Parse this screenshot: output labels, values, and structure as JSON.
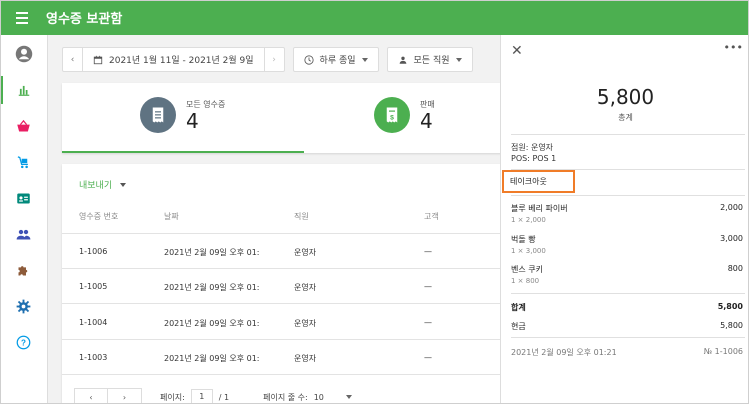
{
  "app": {
    "title": "영수증 보관함"
  },
  "sidebar": {
    "items": [
      {
        "icon": "account-circle-icon"
      },
      {
        "icon": "bar-chart-icon",
        "active": true
      },
      {
        "icon": "basket-icon"
      },
      {
        "icon": "cart-icon"
      },
      {
        "icon": "id-card-icon"
      },
      {
        "icon": "people-icon"
      },
      {
        "icon": "puzzle-icon"
      },
      {
        "icon": "gear-icon"
      },
      {
        "icon": "help-icon"
      }
    ],
    "accent": "#4caf50"
  },
  "filters": {
    "date_range": "2021년 1월 11일 - 2021년 2월 9일",
    "time": "하루 종일",
    "employee": "모든 직원"
  },
  "summary": {
    "all_receipts": {
      "label": "모든 영수증",
      "value": "4"
    },
    "sales": {
      "label": "판매",
      "value": "4"
    }
  },
  "table": {
    "export_label": "내보내기",
    "headers": [
      "영수증 번호",
      "날짜",
      "직원",
      "고객"
    ],
    "rows": [
      {
        "id": "1-1006",
        "date": "2021년 2월 09일 오후 01:",
        "employee": "운영자",
        "customer": "—"
      },
      {
        "id": "1-1005",
        "date": "2021년 2월 09일 오후 01:",
        "employee": "운영자",
        "customer": "—"
      },
      {
        "id": "1-1004",
        "date": "2021년 2월 09일 오후 01:",
        "employee": "운영자",
        "customer": "—"
      },
      {
        "id": "1-1003",
        "date": "2021년 2월 09일 오후 01:",
        "employee": "운영자",
        "customer": "—"
      }
    ],
    "pager": {
      "page_label": "페이지:",
      "page": "1",
      "of": "/ 1",
      "rows_label": "페이지 줄 수:",
      "rows": "10"
    }
  },
  "detail": {
    "total": "5,800",
    "total_label": "총계",
    "cashier": "점원: 운영자",
    "pos": "POS: POS 1",
    "dining_option": "테이크아웃",
    "items": [
      {
        "name": "블루 베리 파이버",
        "qty": "1 × 2,000",
        "price": "2,000"
      },
      {
        "name": "벅돌 빵",
        "qty": "1 × 3,000",
        "price": "3,000"
      },
      {
        "name": "벤스 쿠키",
        "qty": "1 × 800",
        "price": "800"
      }
    ],
    "sum_label": "합계",
    "sum_value": "5,800",
    "cash_label": "현금",
    "cash_value": "5,800",
    "datetime": "2021년 2월 09일 오후 01:21",
    "receipt_no": "№ 1-1006"
  }
}
